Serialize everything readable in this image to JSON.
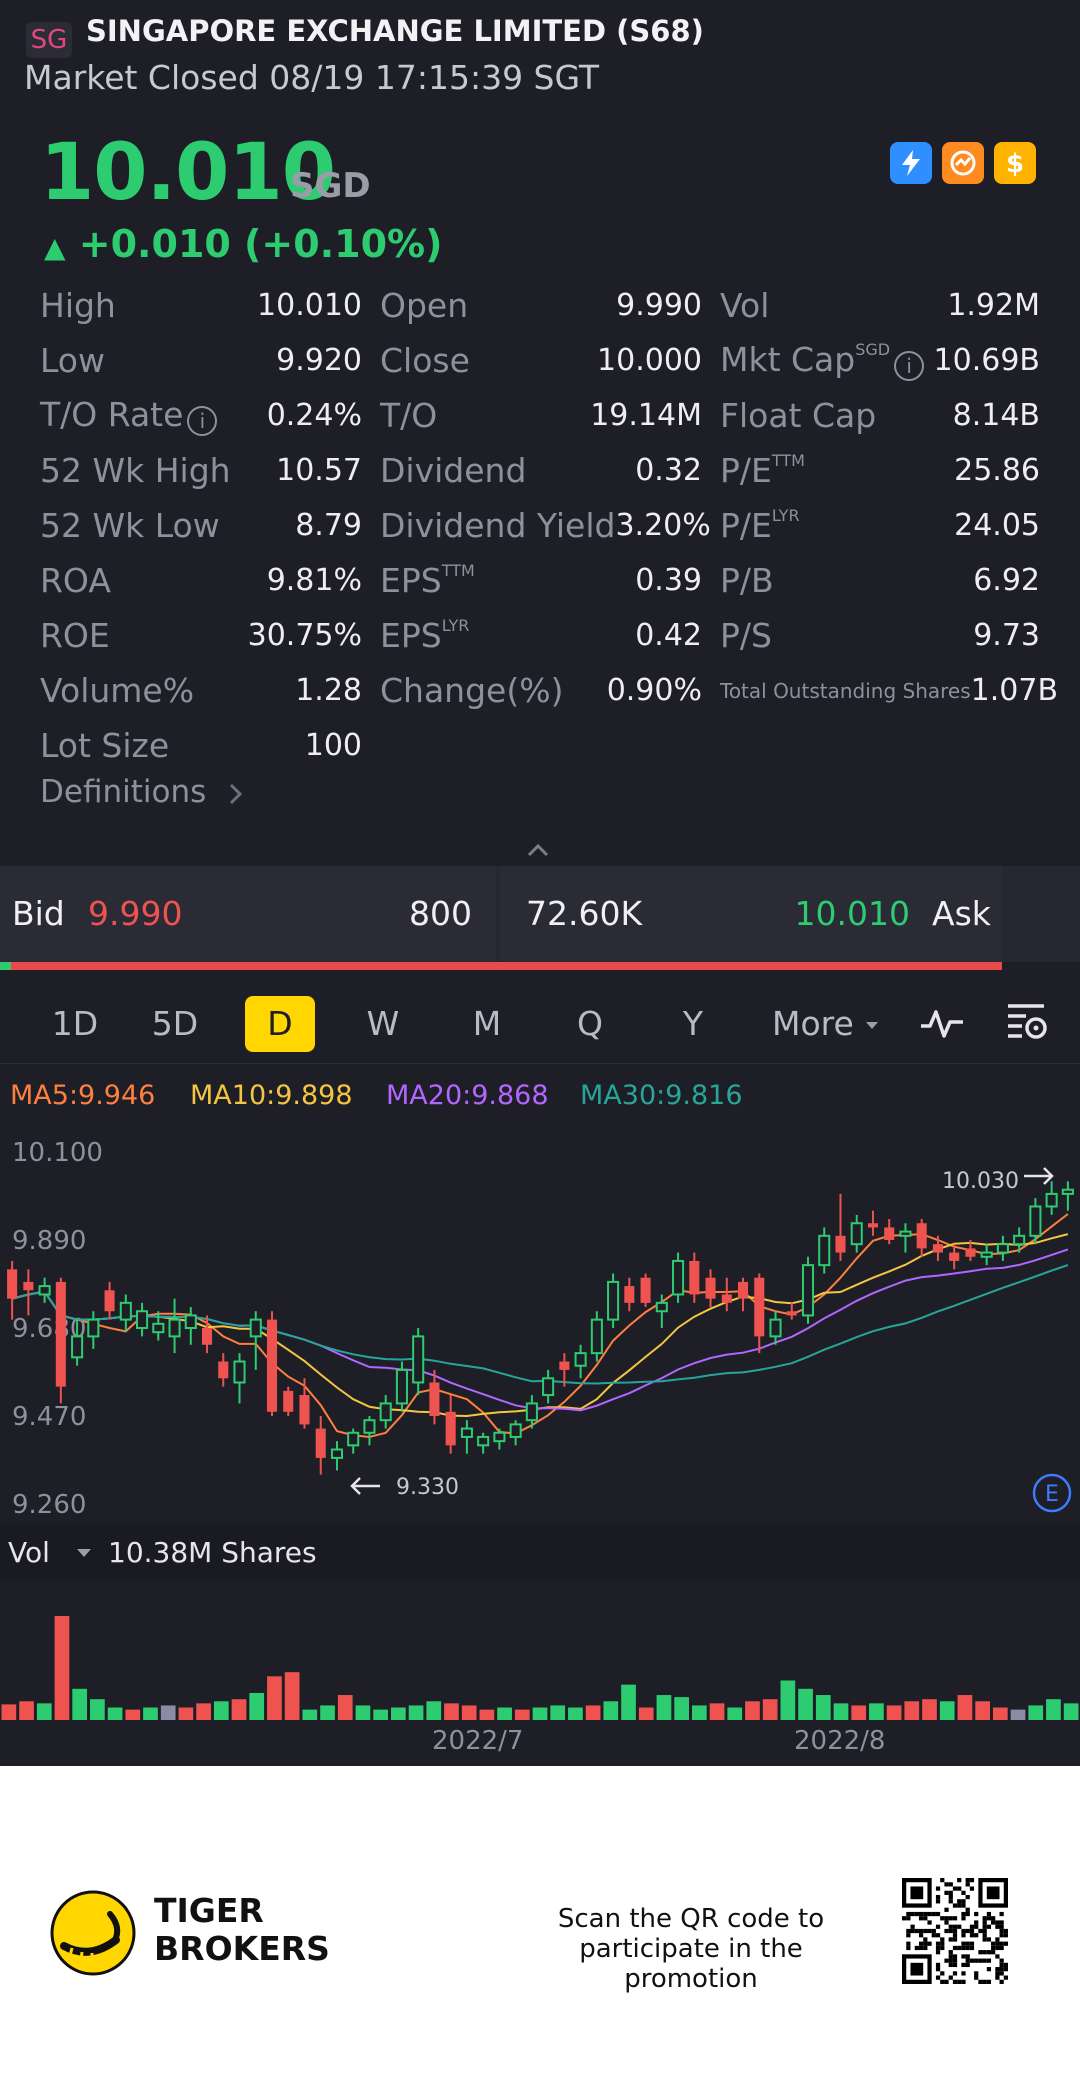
{
  "header": {
    "badge": "SG",
    "title": "SINGAPORE EXCHANGE LIMITED (S68)",
    "status": "Market Closed 08/19 17:15:39 SGT"
  },
  "quote": {
    "price": "10.010",
    "currency": "SGD",
    "change_arrow": "▲",
    "change": "+0.010 (+0.10%)",
    "badges": [
      "lightning-icon",
      "fire-icon",
      "dollar-icon"
    ]
  },
  "stats": {
    "rows": [
      [
        {
          "label": "High",
          "value": "10.010"
        },
        {
          "label": "Open",
          "value": "9.990"
        },
        {
          "label": "Vol",
          "value": "1.92M"
        }
      ],
      [
        {
          "label": "Low",
          "value": "9.920"
        },
        {
          "label": "Close",
          "value": "10.000"
        },
        {
          "label": "Mkt Cap",
          "sup": "SGD",
          "value": "10.69B"
        }
      ],
      [
        {
          "label": "T/O Rate",
          "value": "0.24%"
        },
        {
          "label": "T/O",
          "value": "19.14M"
        },
        {
          "label": "Float Cap",
          "value": "8.14B"
        }
      ],
      [
        {
          "label": "52 Wk High",
          "value": "10.57"
        },
        {
          "label": "Dividend",
          "value": "0.32"
        },
        {
          "label": "P/E",
          "sup": "TTM",
          "value": "25.86"
        }
      ],
      [
        {
          "label": "52 Wk Low",
          "value": "8.79"
        },
        {
          "label": "Dividend Yield",
          "value": "3.20%"
        },
        {
          "label": "P/E",
          "sup": "LYR",
          "value": "24.05"
        }
      ],
      [
        {
          "label": "ROA",
          "value": "9.81%"
        },
        {
          "label": "EPS",
          "sup": "TTM",
          "value": "0.39"
        },
        {
          "label": "P/B",
          "value": "6.92"
        }
      ],
      [
        {
          "label": "ROE",
          "value": "30.75%"
        },
        {
          "label": "EPS",
          "sup": "LYR",
          "value": "0.42"
        },
        {
          "label": "P/S",
          "value": "9.73"
        }
      ],
      [
        {
          "label": "Volume%",
          "value": "1.28"
        },
        {
          "label": "Change(%)",
          "value": "0.90%"
        },
        {
          "label": "Total Outstanding Shares",
          "value": "1.07B"
        }
      ],
      [
        {
          "label": "Lot Size",
          "value": "100"
        }
      ]
    ],
    "definitions": "Definitions"
  },
  "orderbook": {
    "bid_label": "Bid",
    "bid_price": "9.990",
    "bid_size": "800",
    "ask_size": "72.60K",
    "ask_price": "10.010",
    "ask_label": "Ask",
    "bid_share": 0.011
  },
  "periods": {
    "tabs": [
      "1D",
      "5D",
      "D",
      "W",
      "M",
      "Q",
      "Y"
    ],
    "active": "D",
    "more": "More"
  },
  "ma_legend": [
    {
      "text": "MA5:9.946",
      "color": "#ff7f3f"
    },
    {
      "text": "MA10:9.898",
      "color": "#f5c542"
    },
    {
      "text": "MA20:9.868",
      "color": "#b266ff"
    },
    {
      "text": "MA30:9.816",
      "color": "#26a69a"
    }
  ],
  "chart_data": {
    "type": "candlestick",
    "ylim": [
      9.26,
      10.1
    ],
    "yticks": [
      "10.100",
      "9.890",
      "9.680",
      "9.470",
      "9.260"
    ],
    "high_marker": "10.030",
    "low_marker": "9.330",
    "xticks": [
      "2022/7",
      "2022/8"
    ],
    "colors": {
      "up": "#2ecc71",
      "down": "#ef5350"
    },
    "candles": [
      {
        "o": 9.82,
        "h": 9.84,
        "l": 9.7,
        "c": 9.75
      },
      {
        "o": 9.79,
        "h": 9.82,
        "l": 9.71,
        "c": 9.77
      },
      {
        "o": 9.76,
        "h": 9.8,
        "l": 9.74,
        "c": 9.78
      },
      {
        "o": 9.79,
        "h": 9.8,
        "l": 9.5,
        "c": 9.54
      },
      {
        "o": 9.61,
        "h": 9.7,
        "l": 9.59,
        "c": 9.66
      },
      {
        "o": 9.66,
        "h": 9.72,
        "l": 9.63,
        "c": 9.7
      },
      {
        "o": 9.77,
        "h": 9.79,
        "l": 9.7,
        "c": 9.72
      },
      {
        "o": 9.7,
        "h": 9.76,
        "l": 9.67,
        "c": 9.74
      },
      {
        "o": 9.68,
        "h": 9.74,
        "l": 9.66,
        "c": 9.72
      },
      {
        "o": 9.67,
        "h": 9.72,
        "l": 9.65,
        "c": 9.69
      },
      {
        "o": 9.66,
        "h": 9.75,
        "l": 9.62,
        "c": 9.7
      },
      {
        "o": 9.68,
        "h": 9.73,
        "l": 9.64,
        "c": 9.71
      },
      {
        "o": 9.68,
        "h": 9.71,
        "l": 9.62,
        "c": 9.64
      },
      {
        "o": 9.6,
        "h": 9.62,
        "l": 9.54,
        "c": 9.56
      },
      {
        "o": 9.55,
        "h": 9.62,
        "l": 9.5,
        "c": 9.6
      },
      {
        "o": 9.66,
        "h": 9.72,
        "l": 9.58,
        "c": 9.7
      },
      {
        "o": 9.7,
        "h": 9.72,
        "l": 9.47,
        "c": 9.48
      },
      {
        "o": 9.53,
        "h": 9.54,
        "l": 9.47,
        "c": 9.48
      },
      {
        "o": 9.52,
        "h": 9.56,
        "l": 9.44,
        "c": 9.45
      },
      {
        "o": 9.44,
        "h": 9.47,
        "l": 9.33,
        "c": 9.37
      },
      {
        "o": 9.37,
        "h": 9.41,
        "l": 9.34,
        "c": 9.39
      },
      {
        "o": 9.4,
        "h": 9.44,
        "l": 9.38,
        "c": 9.43
      },
      {
        "o": 9.43,
        "h": 9.47,
        "l": 9.4,
        "c": 9.46
      },
      {
        "o": 9.46,
        "h": 9.52,
        "l": 9.44,
        "c": 9.5
      },
      {
        "o": 9.5,
        "h": 9.6,
        "l": 9.48,
        "c": 9.58
      },
      {
        "o": 9.55,
        "h": 9.68,
        "l": 9.52,
        "c": 9.66
      },
      {
        "o": 9.55,
        "h": 9.58,
        "l": 9.45,
        "c": 9.47
      },
      {
        "o": 9.48,
        "h": 9.52,
        "l": 9.38,
        "c": 9.4
      },
      {
        "o": 9.42,
        "h": 9.46,
        "l": 9.38,
        "c": 9.44
      },
      {
        "o": 9.4,
        "h": 9.43,
        "l": 9.38,
        "c": 9.42
      },
      {
        "o": 9.41,
        "h": 9.44,
        "l": 9.39,
        "c": 9.43
      },
      {
        "o": 9.42,
        "h": 9.46,
        "l": 9.4,
        "c": 9.45
      },
      {
        "o": 9.46,
        "h": 9.52,
        "l": 9.44,
        "c": 9.5
      },
      {
        "o": 9.52,
        "h": 9.58,
        "l": 9.5,
        "c": 9.56
      },
      {
        "o": 9.6,
        "h": 9.62,
        "l": 9.54,
        "c": 9.58
      },
      {
        "o": 9.59,
        "h": 9.64,
        "l": 9.56,
        "c": 9.62
      },
      {
        "o": 9.62,
        "h": 9.72,
        "l": 9.6,
        "c": 9.7
      },
      {
        "o": 9.7,
        "h": 9.81,
        "l": 9.68,
        "c": 9.79
      },
      {
        "o": 9.78,
        "h": 9.8,
        "l": 9.72,
        "c": 9.74
      },
      {
        "o": 9.8,
        "h": 9.81,
        "l": 9.73,
        "c": 9.74
      },
      {
        "o": 9.72,
        "h": 9.76,
        "l": 9.68,
        "c": 9.74
      },
      {
        "o": 9.76,
        "h": 9.86,
        "l": 9.74,
        "c": 9.84
      },
      {
        "o": 9.84,
        "h": 9.86,
        "l": 9.74,
        "c": 9.76
      },
      {
        "o": 9.8,
        "h": 9.82,
        "l": 9.73,
        "c": 9.75
      },
      {
        "o": 9.76,
        "h": 9.8,
        "l": 9.72,
        "c": 9.74
      },
      {
        "o": 9.79,
        "h": 9.8,
        "l": 9.72,
        "c": 9.75
      },
      {
        "o": 9.8,
        "h": 9.81,
        "l": 9.62,
        "c": 9.66
      },
      {
        "o": 9.66,
        "h": 9.72,
        "l": 9.64,
        "c": 9.7
      },
      {
        "o": 9.72,
        "h": 9.74,
        "l": 9.7,
        "c": 9.71
      },
      {
        "o": 9.71,
        "h": 9.85,
        "l": 9.69,
        "c": 9.83
      },
      {
        "o": 9.83,
        "h": 9.92,
        "l": 9.81,
        "c": 9.9
      },
      {
        "o": 9.9,
        "h": 10.0,
        "l": 9.84,
        "c": 9.86
      },
      {
        "o": 9.88,
        "h": 9.95,
        "l": 9.86,
        "c": 9.93
      },
      {
        "o": 9.93,
        "h": 9.96,
        "l": 9.9,
        "c": 9.92
      },
      {
        "o": 9.92,
        "h": 9.94,
        "l": 9.88,
        "c": 9.89
      },
      {
        "o": 9.9,
        "h": 9.93,
        "l": 9.86,
        "c": 9.91
      },
      {
        "o": 9.93,
        "h": 9.94,
        "l": 9.85,
        "c": 9.87
      },
      {
        "o": 9.88,
        "h": 9.9,
        "l": 9.84,
        "c": 9.86
      },
      {
        "o": 9.86,
        "h": 9.88,
        "l": 9.82,
        "c": 9.84
      },
      {
        "o": 9.87,
        "h": 9.89,
        "l": 9.84,
        "c": 9.85
      },
      {
        "o": 9.85,
        "h": 9.88,
        "l": 9.83,
        "c": 9.86
      },
      {
        "o": 9.86,
        "h": 9.9,
        "l": 9.84,
        "c": 9.88
      },
      {
        "o": 9.88,
        "h": 9.92,
        "l": 9.86,
        "c": 9.9
      },
      {
        "o": 9.9,
        "h": 9.99,
        "l": 9.88,
        "c": 9.97
      },
      {
        "o": 9.97,
        "h": 10.03,
        "l": 9.95,
        "c": 10.0
      },
      {
        "o": 10.0,
        "h": 10.03,
        "l": 9.96,
        "c": 10.01
      }
    ],
    "volume": {
      "label": "Vol",
      "value": "10.38M Shares",
      "bars": [
        {
          "v": 0.15,
          "d": "down"
        },
        {
          "v": 0.18,
          "d": "down"
        },
        {
          "v": 0.16,
          "d": "up"
        },
        {
          "v": 1.0,
          "d": "down"
        },
        {
          "v": 0.3,
          "d": "up"
        },
        {
          "v": 0.2,
          "d": "up"
        },
        {
          "v": 0.12,
          "d": "up"
        },
        {
          "v": 0.1,
          "d": "down"
        },
        {
          "v": 0.12,
          "d": "up"
        },
        {
          "v": 0.14,
          "d": "flat"
        },
        {
          "v": 0.12,
          "d": "down"
        },
        {
          "v": 0.16,
          "d": "down"
        },
        {
          "v": 0.18,
          "d": "up"
        },
        {
          "v": 0.2,
          "d": "down"
        },
        {
          "v": 0.26,
          "d": "up"
        },
        {
          "v": 0.42,
          "d": "down"
        },
        {
          "v": 0.46,
          "d": "down"
        },
        {
          "v": 0.1,
          "d": "up"
        },
        {
          "v": 0.14,
          "d": "up"
        },
        {
          "v": 0.24,
          "d": "down"
        },
        {
          "v": 0.14,
          "d": "up"
        },
        {
          "v": 0.1,
          "d": "up"
        },
        {
          "v": 0.12,
          "d": "up"
        },
        {
          "v": 0.14,
          "d": "up"
        },
        {
          "v": 0.18,
          "d": "up"
        },
        {
          "v": 0.16,
          "d": "down"
        },
        {
          "v": 0.14,
          "d": "down"
        },
        {
          "v": 0.1,
          "d": "down"
        },
        {
          "v": 0.12,
          "d": "up"
        },
        {
          "v": 0.1,
          "d": "down"
        },
        {
          "v": 0.12,
          "d": "up"
        },
        {
          "v": 0.14,
          "d": "up"
        },
        {
          "v": 0.12,
          "d": "up"
        },
        {
          "v": 0.14,
          "d": "down"
        },
        {
          "v": 0.18,
          "d": "up"
        },
        {
          "v": 0.34,
          "d": "up"
        },
        {
          "v": 0.12,
          "d": "down"
        },
        {
          "v": 0.24,
          "d": "up"
        },
        {
          "v": 0.22,
          "d": "up"
        },
        {
          "v": 0.14,
          "d": "up"
        },
        {
          "v": 0.16,
          "d": "down"
        },
        {
          "v": 0.12,
          "d": "up"
        },
        {
          "v": 0.18,
          "d": "down"
        },
        {
          "v": 0.2,
          "d": "down"
        },
        {
          "v": 0.38,
          "d": "up"
        },
        {
          "v": 0.3,
          "d": "up"
        },
        {
          "v": 0.24,
          "d": "up"
        },
        {
          "v": 0.16,
          "d": "up"
        },
        {
          "v": 0.14,
          "d": "down"
        },
        {
          "v": 0.16,
          "d": "up"
        },
        {
          "v": 0.14,
          "d": "down"
        },
        {
          "v": 0.18,
          "d": "down"
        },
        {
          "v": 0.2,
          "d": "down"
        },
        {
          "v": 0.18,
          "d": "up"
        },
        {
          "v": 0.24,
          "d": "down"
        },
        {
          "v": 0.18,
          "d": "down"
        },
        {
          "v": 0.12,
          "d": "down"
        },
        {
          "v": 0.1,
          "d": "flat"
        },
        {
          "v": 0.14,
          "d": "up"
        },
        {
          "v": 0.2,
          "d": "up"
        },
        {
          "v": 0.16,
          "d": "up"
        }
      ]
    }
  },
  "footer": {
    "brand_line1": "TIGER",
    "brand_line2": "BROKERS",
    "promo": "Scan the QR code to participate in the promotion"
  }
}
